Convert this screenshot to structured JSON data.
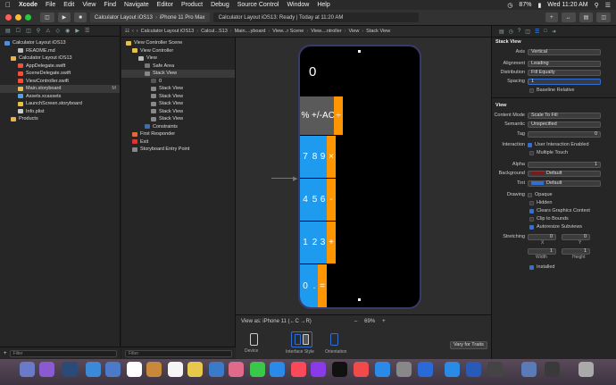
{
  "menubar": {
    "app": "Xcode",
    "items": [
      "File",
      "Edit",
      "View",
      "Find",
      "Navigate",
      "Editor",
      "Product",
      "Debug",
      "Source Control",
      "Window",
      "Help"
    ],
    "battery": "87%",
    "clock": "Wed 11:20 AM"
  },
  "toolbar": {
    "scheme": "Calculator Layout iOS13",
    "device": "iPhone 11 Pro Max",
    "status": "Calculator Layout iOS13: Ready | Today at 11:20 AM"
  },
  "navigator": {
    "items": [
      {
        "label": "Calculator Layout iOS13",
        "indent": 0,
        "kind": "project"
      },
      {
        "label": "README.md",
        "indent": 2,
        "kind": "file"
      },
      {
        "label": "Calculator Layout iOS13",
        "indent": 1,
        "kind": "folder"
      },
      {
        "label": "AppDelegate.swift",
        "indent": 2,
        "kind": "swift"
      },
      {
        "label": "SceneDelegate.swift",
        "indent": 2,
        "kind": "swift"
      },
      {
        "label": "ViewController.swift",
        "indent": 2,
        "kind": "swift"
      },
      {
        "label": "Main.storyboard",
        "indent": 2,
        "kind": "storyboard",
        "selected": true,
        "badge": "M"
      },
      {
        "label": "Assets.xcassets",
        "indent": 2,
        "kind": "assets"
      },
      {
        "label": "LaunchScreen.storyboard",
        "indent": 2,
        "kind": "storyboard"
      },
      {
        "label": "Info.plist",
        "indent": 2,
        "kind": "plist"
      },
      {
        "label": "Products",
        "indent": 1,
        "kind": "folder"
      }
    ],
    "filter_placeholder": "Filter"
  },
  "outline": {
    "items": [
      {
        "label": "View Controller Scene",
        "indent": 0
      },
      {
        "label": "View Controller",
        "indent": 1
      },
      {
        "label": "View",
        "indent": 2
      },
      {
        "label": "Safe Area",
        "indent": 3
      },
      {
        "label": "Stack View",
        "indent": 3
      },
      {
        "label": "0",
        "indent": 4
      },
      {
        "label": "Stack View",
        "indent": 4
      },
      {
        "label": "Stack View",
        "indent": 4
      },
      {
        "label": "Stack View",
        "indent": 4
      },
      {
        "label": "Stack View",
        "indent": 4
      },
      {
        "label": "Stack View",
        "indent": 4
      },
      {
        "label": "Constraints",
        "indent": 3
      },
      {
        "label": "First Responder",
        "indent": 1
      },
      {
        "label": "Exit",
        "indent": 1
      },
      {
        "label": "Storyboard Entry Point",
        "indent": 1
      }
    ],
    "filter_placeholder": "Filter"
  },
  "jumpbar": {
    "crumbs": [
      "Calculator Layout iOS13",
      "Calcul...S13",
      "Main....yboard",
      "View...r Scene",
      "View....ntroller",
      "View",
      "Stack View"
    ]
  },
  "calculator": {
    "display": "0",
    "rows": [
      [
        "%",
        "+/-",
        "AC",
        "÷"
      ],
      [
        "7",
        "8",
        "9",
        "×"
      ],
      [
        "4",
        "5",
        "6",
        "-"
      ],
      [
        "1",
        "2",
        "3",
        "+"
      ],
      [
        "0",
        ".",
        "="
      ]
    ],
    "colors": {
      "gray": "#5a5a5a",
      "blue": "#1e9bef",
      "orange": "#ff9500"
    }
  },
  "bottombar": {
    "view_as": "View as: iPhone 11 (←C →R)",
    "zoom": "69%",
    "device_label": "Device",
    "interface_label": "Interface Style",
    "orientation_label": "Orientation",
    "vary_button": "Vary for Traits"
  },
  "inspector": {
    "stack_header": "Stack View",
    "axis_label": "Axis",
    "axis_value": "Vertical",
    "alignment_label": "Alignment",
    "alignment_value": "Leading",
    "distribution_label": "Distribution",
    "distribution_value": "Fill Equally",
    "spacing_label": "Spacing",
    "spacing_value": "1",
    "baseline_label": "Baseline Relative",
    "view_header": "View",
    "content_mode_label": "Content Mode",
    "content_mode_value": "Scale To Fill",
    "semantic_label": "Semantic",
    "semantic_value": "Unspecified",
    "tag_label": "Tag",
    "tag_value": "0",
    "interaction_label": "Interaction",
    "user_interaction": "User Interaction Enabled",
    "multiple_touch": "Multiple Touch",
    "alpha_label": "Alpha",
    "alpha_value": "1",
    "background_label": "Background",
    "background_value": "Default",
    "tint_label": "Tint",
    "tint_value": "Default",
    "drawing_label": "Drawing",
    "opaque": "Opaque",
    "hidden": "Hidden",
    "clears": "Clears Graphics Context",
    "clip": "Clip to Bounds",
    "autoresize": "Autoresize Subviews",
    "stretching_label": "Stretching",
    "x_label": "X",
    "y_label": "Y",
    "width_label": "Width",
    "height_label": "Height",
    "stretch_x": "0",
    "stretch_y": "0",
    "stretch_w": "1",
    "stretch_h": "1",
    "installed": "Installed"
  }
}
